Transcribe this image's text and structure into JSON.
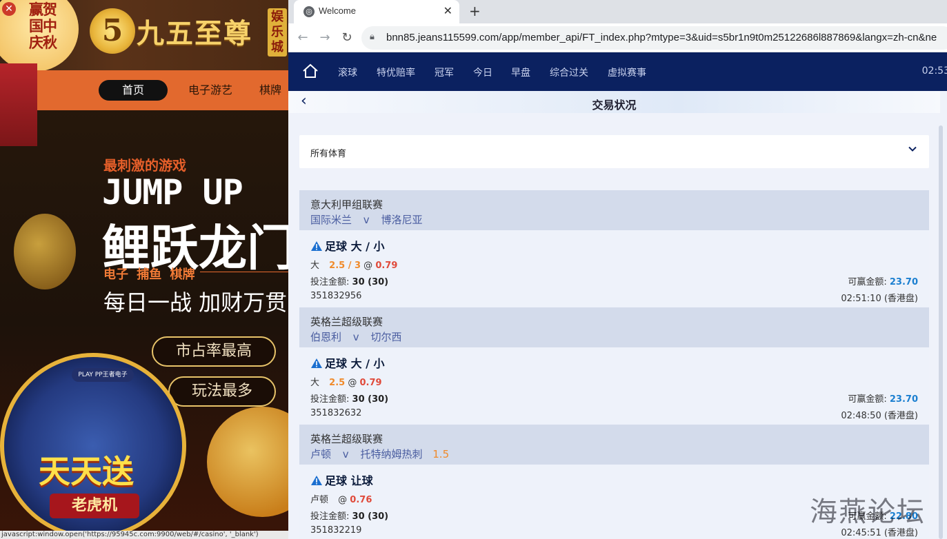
{
  "promo": {
    "festival_text": "赢贺国中庆秋",
    "brand_logo_glyph": "5",
    "brand_name": "九五至尊",
    "brand_tag": "娱乐城",
    "nav": [
      "首页",
      "电子游艺",
      "棋牌"
    ],
    "hero_sub": "最刺激的游戏",
    "hero_en": "JUMP UP",
    "hero_cn": "鲤跃龙门",
    "hero_cats": "电子 捕鱼 棋牌",
    "hero_slogan": "每日一战 加财万贯",
    "pill_1": "市占率最高",
    "pill_2": "玩法最多",
    "pp_badge": "PLAY PP王者电子",
    "slot_title": "天天送",
    "slot_ribbon": "老虎机",
    "status_url": "javascript:window.open('https://95945c.com:9900/web/#/casino', '_blank')"
  },
  "browser": {
    "tab_title": "Welcome",
    "tab_close": "✕",
    "new_tab": "+",
    "url": "bnn85.jeans115599.com/app/member_api/FT_index.php?mtype=3&uid=s5br1n9t0m25122686l887869&langx=zh-cn&ne"
  },
  "page": {
    "nav": [
      "滚球",
      "特优赔率",
      "冠军",
      "今日",
      "早盘",
      "综合过关",
      "虚拟赛事"
    ],
    "clock": "02:53",
    "title": "交易状况",
    "filter": "所有体育",
    "labels": {
      "stake": "投注金额:",
      "win": "可赢金额:",
      "vs": "v",
      "at": "@"
    },
    "bets": [
      {
        "league": "意大利甲组联赛",
        "home": "国际米兰",
        "away": "博洛尼亚",
        "handicap": "",
        "type": "足球 大 / 小",
        "pick": "大",
        "line": "2.5 / 3",
        "odds": "0.79",
        "stake": "30 (30)",
        "win": "23.70",
        "ticket": "351832956",
        "time": "02:51:10 (香港盘)"
      },
      {
        "league": "英格兰超级联赛",
        "home": "伯恩利",
        "away": "切尔西",
        "handicap": "",
        "type": "足球 大 / 小",
        "pick": "大",
        "line": "2.5",
        "odds": "0.79",
        "stake": "30 (30)",
        "win": "23.70",
        "ticket": "351832632",
        "time": "02:48:50 (香港盘)"
      },
      {
        "league": "英格兰超级联赛",
        "home": "卢顿",
        "away": "托特纳姆热刺",
        "handicap": "1.5",
        "type": "足球 让球",
        "pick": "卢顿",
        "line": "",
        "odds": "0.76",
        "stake": "30 (30)",
        "win": "22.80",
        "ticket": "351832219",
        "time": "02:45:51 (香港盘)"
      }
    ],
    "watermark": "海燕论坛"
  },
  "colors": {
    "nav_bg": "#0b2160",
    "accent_orange": "#f08a2a",
    "odds_red": "#e04a3a",
    "win_blue": "#1b7fd0"
  }
}
